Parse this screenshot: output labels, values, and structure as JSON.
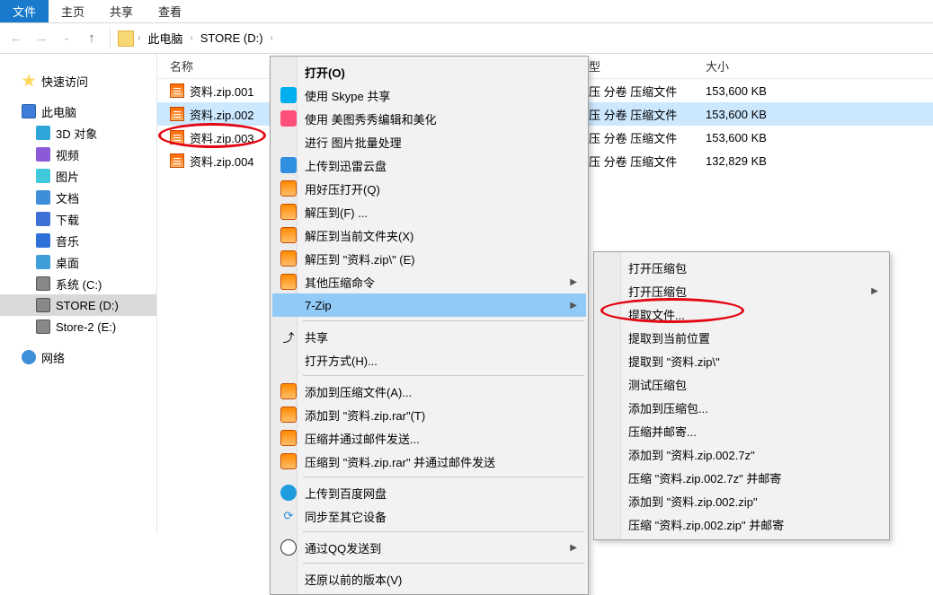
{
  "ribbon": {
    "file": "文件",
    "tabs": [
      "主页",
      "共享",
      "查看"
    ]
  },
  "nav": {
    "up_tooltip": "上",
    "crumbs": [
      "此电脑",
      "STORE (D:)"
    ]
  },
  "columns": {
    "name": "名称",
    "type": "型",
    "size": "大小"
  },
  "sidebar": {
    "quick": "快速访问",
    "thispc": "此电脑",
    "children": [
      "3D 对象",
      "视频",
      "图片",
      "文档",
      "下载",
      "音乐",
      "桌面",
      "系统 (C:)",
      "STORE (D:)",
      "Store-2 (E:)"
    ],
    "network": "网络"
  },
  "files": [
    {
      "name": "资料.zip.001",
      "type": "压 分卷 压缩文件",
      "size": "153,600 KB",
      "selected": false
    },
    {
      "name": "资料.zip.002",
      "type": "压 分卷 压缩文件",
      "size": "153,600 KB",
      "selected": true
    },
    {
      "name": "资料.zip.003",
      "type": "压 分卷 压缩文件",
      "size": "153,600 KB",
      "selected": false
    },
    {
      "name": "资料.zip.004",
      "type": "压 分卷 压缩文件",
      "size": "132,829 KB",
      "selected": false
    }
  ],
  "menu1": {
    "open": "打开(O)",
    "skype": "使用 Skype 共享",
    "meitu": "使用 美图秀秀编辑和美化",
    "batch": "进行 图片批量处理",
    "thunder": "上传到迅雷云盘",
    "haozip": "用好压打开(Q)",
    "extract_to": "解压到(F) ...",
    "extract_here": "解压到当前文件夹(X)",
    "extract_named": "解压到 \"资料.zip\\\" (E)",
    "other_compress": "其他压缩命令",
    "sevenzip": "7-Zip",
    "share": "共享",
    "open_with": "打开方式(H)...",
    "add_archive": "添加到压缩文件(A)...",
    "add_rar": "添加到 \"资料.zip.rar\"(T)",
    "compress_mail": "压缩并通过邮件发送...",
    "compress_rar_mail": "压缩到 \"资料.zip.rar\" 并通过邮件发送",
    "baidu": "上传到百度网盘",
    "sync": "同步至其它设备",
    "qq": "通过QQ发送到",
    "restore": "还原以前的版本(V)"
  },
  "menu2": {
    "open1": "打开压缩包",
    "open2": "打开压缩包",
    "extract_files": "提取文件...",
    "extract_here": "提取到当前位置",
    "extract_named": "提取到 \"资料.zip\\\"",
    "test": "测试压缩包",
    "add": "添加到压缩包...",
    "compress_mail": "压缩并邮寄...",
    "add_7z": "添加到 \"资料.zip.002.7z\"",
    "compress_7z_mail": "压缩 \"资料.zip.002.7z\" 并邮寄",
    "add_zip": "添加到 \"资料.zip.002.zip\"",
    "compress_zip_mail": "压缩 \"资料.zip.002.zip\" 并邮寄"
  }
}
